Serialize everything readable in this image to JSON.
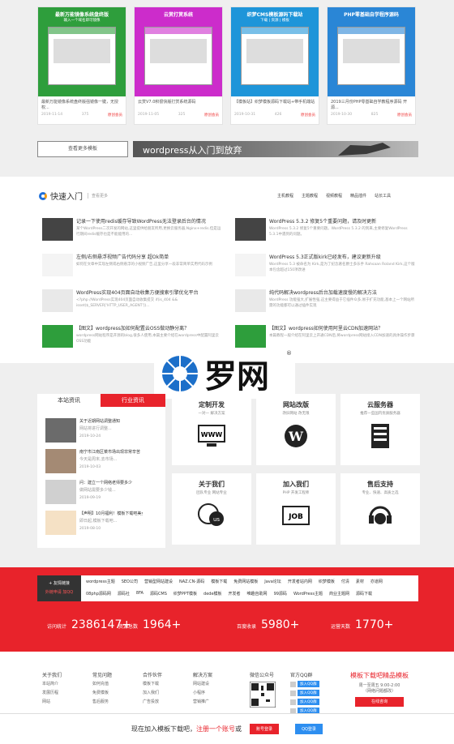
{
  "top_cards": [
    {
      "title": "最新万能镜像系统盘终版",
      "sub": "输入一个域名即可镜像",
      "caption": "最新万能镜像系统盘终版强镜像一键，无授权...",
      "date": "2019-11-14",
      "views": "375",
      "badge": "原创会员",
      "color": "#2e9e3c"
    },
    {
      "title": "云赏打赏系统",
      "sub": "",
      "caption": "云赏V7.0积很快版打赏系统源码",
      "date": "2019-11-05",
      "views": "325",
      "badge": "原创会员",
      "color": "#cc2ccb"
    },
    {
      "title": "织梦CMS模板源码下载站",
      "sub": "下载 | 资源 | 模板",
      "caption": "【模板站】织梦模板源码下载站+带手机端站",
      "date": "2019-10-31",
      "views": "426",
      "badge": "原创会员",
      "color": "#1e95d9"
    },
    {
      "title": "PHP零基础自学程序源码",
      "sub": "",
      "caption": "2019三月份PHP零基础自学教程序源码 开源...",
      "date": "2019-10-30",
      "views": "825",
      "badge": "原创会员",
      "color": "#2a86d6"
    }
  ],
  "more_button": "查看更多模板",
  "banner_text": "wordpress从入门到放弃",
  "quick": {
    "title": "快速入门",
    "more": "查看更多",
    "tabs": [
      "主机教程",
      "主题教程",
      "视频教程",
      "精品插件",
      "站长工具"
    ],
    "items": [
      {
        "title": "记录一下使用redis缓存导致WordPress无法登录后台的情况",
        "desc": "某个WordPress二次开发的网站,这里提供给朋友所用,更换云服务器,Nginx+redis.但是运行期间redis缓存也是不能能用的..."
      },
      {
        "title": "WordPress 5.3.2 修复5个重要问题，请及时更新",
        "desc": "WordPress 5.3.2 修复5个重要问题。WordPress 5.3.2 的到来,主要修复WordPress 5.3.1中遇到的问题。"
      },
      {
        "title": "左侧/右侧悬浮视频广告代码分享 超Ok简单",
        "desc": "如何在文章中实现左侧或右侧悬浮的小视频广告,这里分享一段非常简单实用代码示例"
      },
      {
        "title": "WordPress 5.3正式版kirk已经发布，建议更新升级",
        "desc": "WordPress 5.3 被命名为 Kirk,是为了纪念著名爵士多乐手 Rahsaan Roland Kirk,这个版本包含超过150项改进"
      },
      {
        "title": "WordPress实现404页面自动收集方便搜索引擎优化平台",
        "desc": "<?php //WordPress实现404页面自动收集提交 if(is_404 && isset($_SERVER['HTTP_USER_AGENT'])..."
      },
      {
        "title": "纯代码解决wordpress后台加载速度慢的解决方法",
        "desc": "WordPress 功能强大,扩展性强,这主要得益于它插件众多,易于扩充功能,基本上一个网站所需的功能都可以通过插件实现"
      },
      {
        "title": "【图文】wordpress加如何配置云OSS做动静分离？",
        "desc": "wordpress网站程序是开源的blog,很多人使用,本篇主要介绍在wordpress中配置阿里云OSS功能"
      },
      {
        "title": "【图文】wordpress如何使用阿里云CDN加速网站？",
        "desc": "本篇教程一般介绍在阿里云上开通CDN后,将wordpress网站接入CDN加速的具体操作步骤"
      }
    ]
  },
  "watermark": "罗网",
  "news": {
    "tab_active": "本站资讯",
    "tab_other": "行业资讯",
    "items": [
      {
        "title": "关于近期网站调整通知",
        "sub": "网站将进行调整...",
        "date": "2019-10-24"
      },
      {
        "title": "南宁市江南区菜市场出现非常辛苦",
        "sub": "今天是周末,去市场...",
        "date": "2019-10-03"
      },
      {
        "title": "问：建立一个网络老师要多少",
        "sub": "做网站需要多少钱...",
        "date": "2019-09-19"
      },
      {
        "title": "【声明】10月福利！模板下载吧美女",
        "sub": "即日起,模板下载吧...",
        "date": "2019-08-10"
      }
    ]
  },
  "services": [
    {
      "name": "定制开发",
      "sub": "一对一 解决方案",
      "icon": "www-monitor-icon"
    },
    {
      "name": "网站改版",
      "sub": "改旧网站 改无限",
      "icon": "wordpress-icon"
    },
    {
      "name": "云服务器",
      "sub": "推荐一些国内优质服务器",
      "icon": "server-icon"
    },
    {
      "name": "关于我们",
      "sub": "团队专业 网站专业",
      "icon": "contact-us-icon"
    },
    {
      "name": "加入我们",
      "sub": "PHP 开发工程师",
      "icon": "job-icon"
    },
    {
      "name": "售后支持",
      "sub": "专业、快速、高质之选",
      "icon": "headset-icon"
    }
  ],
  "links": {
    "label": "+ 友情链接",
    "sub": "外链申请 加QQ",
    "row1": [
      "wordpress主题",
      "SEO公司",
      "营销型网站建设",
      "NAZ.CN-源码",
      "模板下载",
      "免费网站模板",
      "Java论坛",
      "开发者站内网",
      "织梦模板",
      "付清",
      "素材",
      "亦道网"
    ],
    "row2": [
      "08php源码网",
      "源码社",
      "8FA",
      "源码CMS",
      "织梦PPT模板",
      "dede模板",
      "开发者",
      "唯趣自助网",
      "99源码",
      "WordPress主题",
      "商业主题网",
      "源码下载"
    ]
  },
  "stats": [
    {
      "label": "访问统计",
      "value": "2386147+"
    },
    {
      "label": "资源总数",
      "value": "1964+"
    },
    {
      "label": "百度收录",
      "value": "5980+"
    },
    {
      "label": "运营天数",
      "value": "1770+"
    }
  ],
  "footer": {
    "cols": [
      {
        "head": "关于我们",
        "items": [
          "本站简介",
          "发展历程",
          "网站"
        ]
      },
      {
        "head": "常见问题",
        "items": [
          "如何充值",
          "免费模板",
          "售后服务"
        ]
      },
      {
        "head": "合作伙伴",
        "items": [
          "模板下载",
          "加入我们",
          "广告投放"
        ]
      },
      {
        "head": "解决方案",
        "items": [
          "网站建设",
          "小程序",
          "营销推广"
        ]
      }
    ],
    "qr_head": "微信公众号",
    "qq_head": "官方QQ群",
    "qq_groups": [
      "加入QQ群",
      "加入QQ群",
      "加入QQ群",
      "加入QQ群"
    ],
    "brand": "模板下载吧精品模板",
    "brand_sub": "周一至周五 9:00-2:00",
    "brand_sub2": "（网络问题都改）",
    "contact_btn": "在线咨询"
  },
  "bottom_bar": {
    "text": "现在加入模板下载吧，",
    "link": "注册一个账号",
    "tail": "或",
    "btn1": "账号登录",
    "btn2": "QQ登录"
  }
}
